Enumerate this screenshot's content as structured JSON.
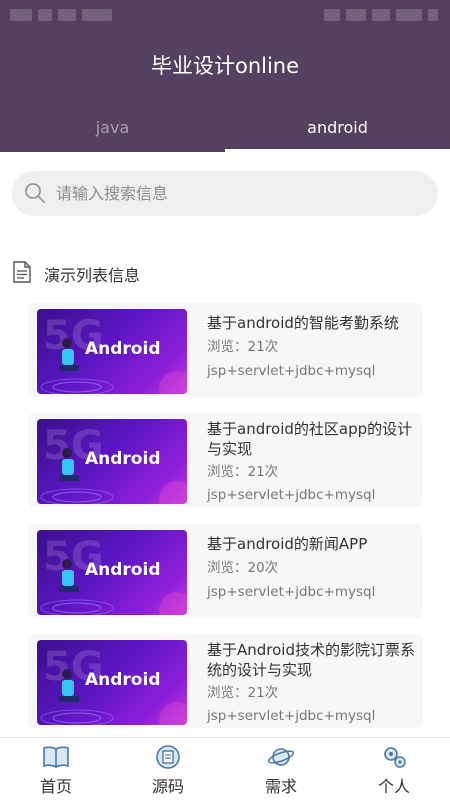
{
  "header": {
    "title": "毕业设计online",
    "tabs": [
      {
        "label": "java",
        "active": false
      },
      {
        "label": "android",
        "active": true
      }
    ]
  },
  "search": {
    "placeholder": "请输入搜索信息",
    "value": ""
  },
  "section": {
    "title": "演示列表信息"
  },
  "list": [
    {
      "title": "基于android的智能考勤系统",
      "views": "浏览：21次",
      "tech": "jsp+servlet+jdbc+mysql",
      "thumb_label": "Android"
    },
    {
      "title": "基于android的社区app的设计与实现",
      "views": "浏览：21次",
      "tech": "jsp+servlet+jdbc+mysql",
      "thumb_label": "Android"
    },
    {
      "title": "基于android的新闻APP",
      "views": "浏览：20次",
      "tech": "jsp+servlet+jdbc+mysql",
      "thumb_label": "Android"
    },
    {
      "title": "基于Android技术的影院订票系统的设计与实现",
      "views": "浏览：21次",
      "tech": "jsp+servlet+jdbc+mysql",
      "thumb_label": "Android"
    }
  ],
  "nav": [
    {
      "label": "首页",
      "icon": "book-icon"
    },
    {
      "label": "源码",
      "icon": "code-icon"
    },
    {
      "label": "需求",
      "icon": "planet-icon"
    },
    {
      "label": "个人",
      "icon": "gear-icon"
    }
  ],
  "colors": {
    "header_bg": "#54405f",
    "tab_inactive": "#a99fb1",
    "nav_icon": "#4a78a8"
  }
}
